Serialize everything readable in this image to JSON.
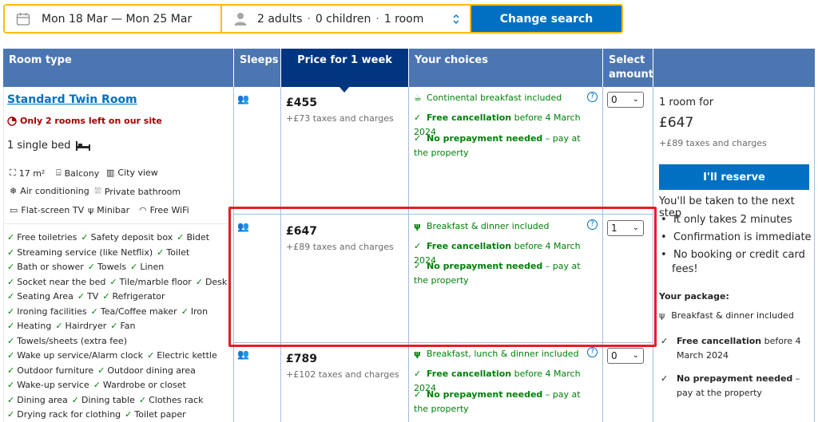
{
  "search": {
    "dates": "Mon 18 Mar — Mon 25 Mar",
    "guests": "2 adults",
    "children": "0 children",
    "rooms": "1 room",
    "button": "Change search"
  },
  "table": {
    "headers": {
      "room_type": "Room type",
      "sleeps": "Sleeps",
      "price": "Price for 1 week",
      "choices": "Your choices",
      "select": "Select amount"
    }
  },
  "room": {
    "title": "Standard Twin Room",
    "scarcity": "Only 2 rooms left on our site",
    "bed": "1 single bed",
    "facilities_row1": [
      "17 m²",
      "Balcony",
      "City view"
    ],
    "facilities_row2": [
      "Air conditioning",
      "Private bathroom"
    ],
    "facilities_row3": [
      "Flat-screen TV",
      "Minibar",
      "Free WiFi"
    ],
    "amenities": [
      [
        "Free toiletries",
        "Safety deposit box",
        "Bidet"
      ],
      [
        "Streaming service (like Netflix)",
        "Toilet"
      ],
      [
        "Bath or shower",
        "Towels",
        "Linen"
      ],
      [
        "Socket near the bed",
        "Tile/marble floor",
        "Desk"
      ],
      [
        "Seating Area",
        "TV",
        "Refrigerator"
      ],
      [
        "Ironing facilities",
        "Tea/Coffee maker",
        "Iron"
      ],
      [
        "Heating",
        "Hairdryer",
        "Fan"
      ],
      [
        "Towels/sheets (extra fee)"
      ],
      [
        "Wake up service/Alarm clock",
        "Electric kettle"
      ],
      [
        "Outdoor furniture",
        "Outdoor dining area"
      ],
      [
        "Wake-up service",
        "Wardrobe or closet"
      ],
      [
        "Dining area",
        "Dining table",
        "Clothes rack"
      ],
      [
        "Drying rack for clothing",
        "Toilet paper"
      ]
    ]
  },
  "options": [
    {
      "price": "£455",
      "taxes": "+£73 taxes and charges",
      "meal": "Continental breakfast included",
      "cancel_bold": "Free cancellation",
      "cancel_rest": " before 4 March 2024",
      "prepay_bold": "No prepayment needed",
      "prepay_rest": " – pay at the property",
      "selected": "0"
    },
    {
      "price": "£647",
      "taxes": "+£89 taxes and charges",
      "meal": "Breakfast & dinner included",
      "cancel_bold": "Free cancellation",
      "cancel_rest": " before 4 March 2024",
      "prepay_bold": "No prepayment needed",
      "prepay_rest": " – pay at the property",
      "selected": "1"
    },
    {
      "price": "£789",
      "taxes": "+£102 taxes and charges",
      "meal": "Breakfast, lunch & dinner included",
      "cancel_bold": "Free cancellation",
      "cancel_rest": " before 4 March 2024",
      "prepay_bold": "No prepayment needed",
      "prepay_rest": " – pay at the property",
      "selected": "0"
    }
  ],
  "summary": {
    "rooms_for": "1 room for",
    "total": "£647",
    "taxes": "+£89 taxes and charges",
    "reserve": "I'll reserve",
    "next_step": "You'll be taken to the next step",
    "bullets": [
      "It only takes 2 minutes",
      "Confirmation is immediate",
      "No booking or credit card fees!"
    ],
    "package_title": "Your package:",
    "package_meal": "Breakfast & dinner included",
    "package_cancel_bold": "Free cancellation",
    "package_cancel_rest": " before 4 March 2024",
    "package_prepay_bold": "No prepayment needed",
    "package_prepay_rest": " – pay at the property"
  },
  "colors": {
    "brand_blue": "#0071c2",
    "header_blue": "#4c76b2",
    "dark_blue": "#003580",
    "search_yellow": "#febb02",
    "green": "#008009",
    "scarcity_red": "#a30000",
    "highlight_red": "#e41e26"
  }
}
